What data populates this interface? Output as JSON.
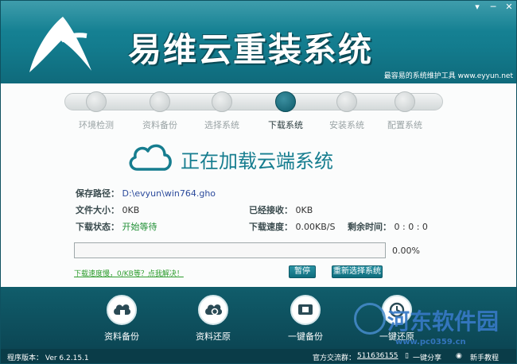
{
  "app": {
    "title": "易维云重装系统",
    "tagline": "最容易的系统维护工具 www.eyyun.net",
    "window_controls": [
      "▾",
      "─",
      "✕"
    ]
  },
  "steps": [
    {
      "label": "环境检测",
      "active": false
    },
    {
      "label": "资料备份",
      "active": false
    },
    {
      "label": "选择系统",
      "active": false
    },
    {
      "label": "下载系统",
      "active": true
    },
    {
      "label": "安装系统",
      "active": false
    },
    {
      "label": "配置系统",
      "active": false
    }
  ],
  "status": {
    "title": "正在加载云端系统",
    "save_path_label": "保存路径：",
    "save_path": "D:\\evyun\\win764.gho",
    "file_size_label": "文件大小：",
    "file_size": "0KB",
    "received_label": "已经接收：",
    "received": "0KB",
    "download_status_label": "下载状态：",
    "download_status": "开始等待",
    "download_speed_label": "下载速度：",
    "download_speed": "0.00KB/S",
    "remaining_label": "剩余时间：",
    "remaining": "0 : 0 : 0",
    "progress_percent": 0,
    "progress_text": "0.00%",
    "slow_link": "下载速度慢，0/KB等？点我解决！",
    "pause_button": "暂停",
    "reselect_button": "重新选择系统"
  },
  "actions": [
    {
      "label": "资料备份",
      "icon": "cloud-backup-icon"
    },
    {
      "label": "资料还原",
      "icon": "cloud-restore-icon"
    },
    {
      "label": "一键备份",
      "icon": "drive-backup-icon"
    },
    {
      "label": "一键还原",
      "icon": "clock-restore-icon"
    }
  ],
  "statusbar": {
    "version": "程序版本： Ver 6.2.15.1",
    "qq_group_label": "官方交流群：",
    "qq_group": "511636155",
    "share": "一键分享",
    "tutorial": "新手教程"
  },
  "watermark": {
    "text": "河东软件园",
    "url": "www.pc0359.cn"
  },
  "colors": {
    "header": "#137c8e",
    "footer": "#0c4654",
    "accent": "#167d8f",
    "link_green": "#2d9c2d"
  }
}
